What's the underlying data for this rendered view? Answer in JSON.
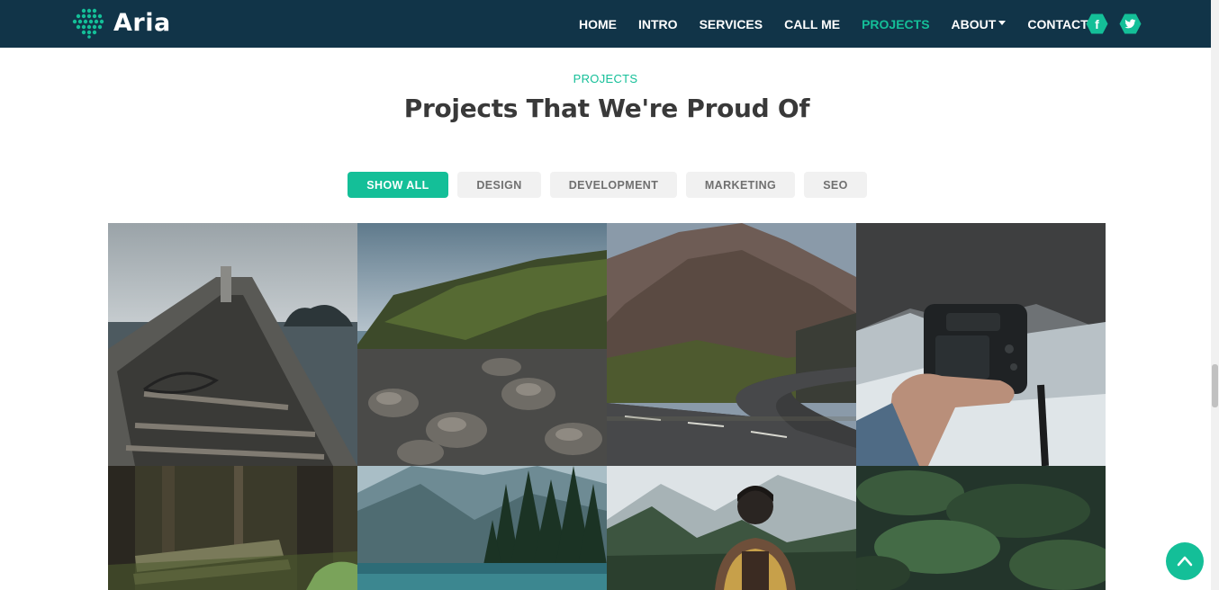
{
  "brand": {
    "name": "Aria"
  },
  "nav": {
    "links": [
      "HOME",
      "INTRO",
      "SERVICES",
      "CALL ME",
      "PROJECTS",
      "ABOUT",
      "CONTACT"
    ],
    "active": "PROJECTS",
    "social": [
      {
        "icon": "facebook-icon",
        "glyph": "f"
      },
      {
        "icon": "twitter-icon",
        "glyph": "t"
      }
    ]
  },
  "section": {
    "label": "PROJECTS",
    "title": "Projects That We're Proud Of"
  },
  "filters": {
    "items": [
      "SHOW ALL",
      "DESIGN",
      "DEVELOPMENT",
      "MARKETING",
      "SEO"
    ],
    "active": "SHOW ALL"
  },
  "gallery": {
    "tiles": [
      {
        "icon": "boat-photo"
      },
      {
        "icon": "rocky-coast-photo"
      },
      {
        "icon": "mountain-road-photo"
      },
      {
        "icon": "camera-in-hand-photo"
      },
      {
        "icon": "forest-bench-photo"
      },
      {
        "icon": "mountain-lake-photo"
      },
      {
        "icon": "hiker-photo"
      },
      {
        "icon": "green-forest-photo"
      }
    ]
  },
  "colors": {
    "navbar": "#113448",
    "accent": "#14bf98",
    "title": "#393939",
    "filter_bg": "#f1f1f1",
    "filter_text": "#707070"
  },
  "back_to_top": {
    "icon": "chevron-up-icon"
  }
}
